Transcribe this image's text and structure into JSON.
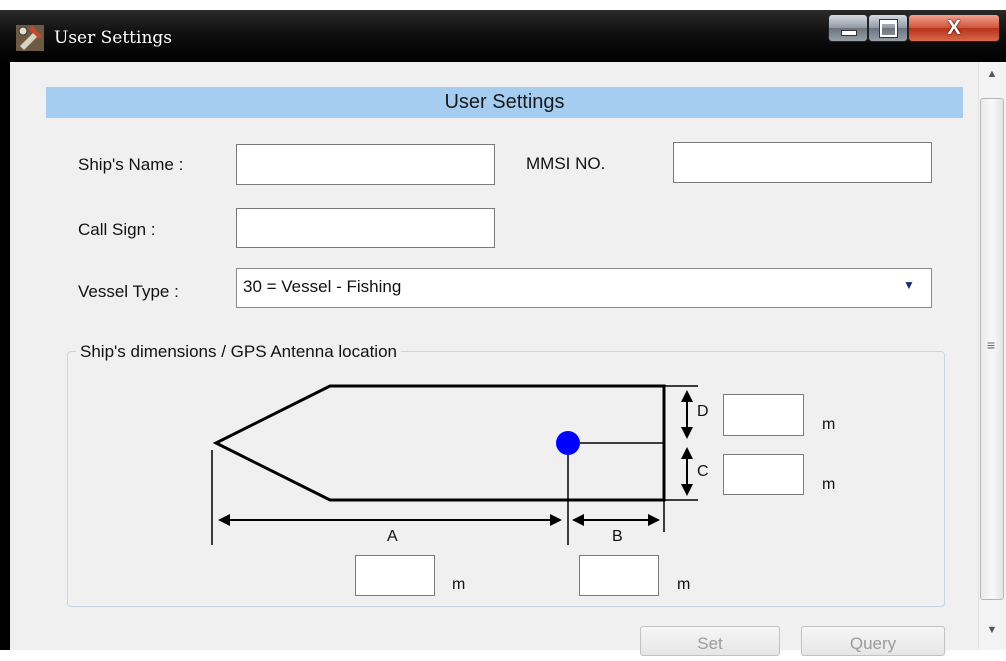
{
  "window": {
    "title": "User Settings",
    "close_glyph": "X"
  },
  "header": {
    "title": "User Settings"
  },
  "form": {
    "ships_name_label": "Ship's Name :",
    "ships_name_value": "",
    "mmsi_label": "MMSI NO.",
    "mmsi_value": "",
    "call_sign_label": "Call Sign :",
    "call_sign_value": "",
    "vessel_type_label": "Vessel Type :",
    "vessel_type_value": "30 = Vessel - Fishing"
  },
  "dimensions": {
    "group_title": "Ship's dimensions / GPS Antenna location",
    "label_a": "A",
    "label_b": "B",
    "label_c": "C",
    "label_d": "D",
    "unit": "m",
    "value_a": "",
    "value_b": "",
    "value_c": "",
    "value_d": ""
  },
  "buttons": {
    "set": "Set",
    "query": "Query"
  },
  "colors": {
    "header_bg": "#a5cdf1",
    "antenna_dot": "#0000ff"
  },
  "icons": {
    "app": "tools-icon",
    "dropdown": "chevron-down-icon"
  }
}
